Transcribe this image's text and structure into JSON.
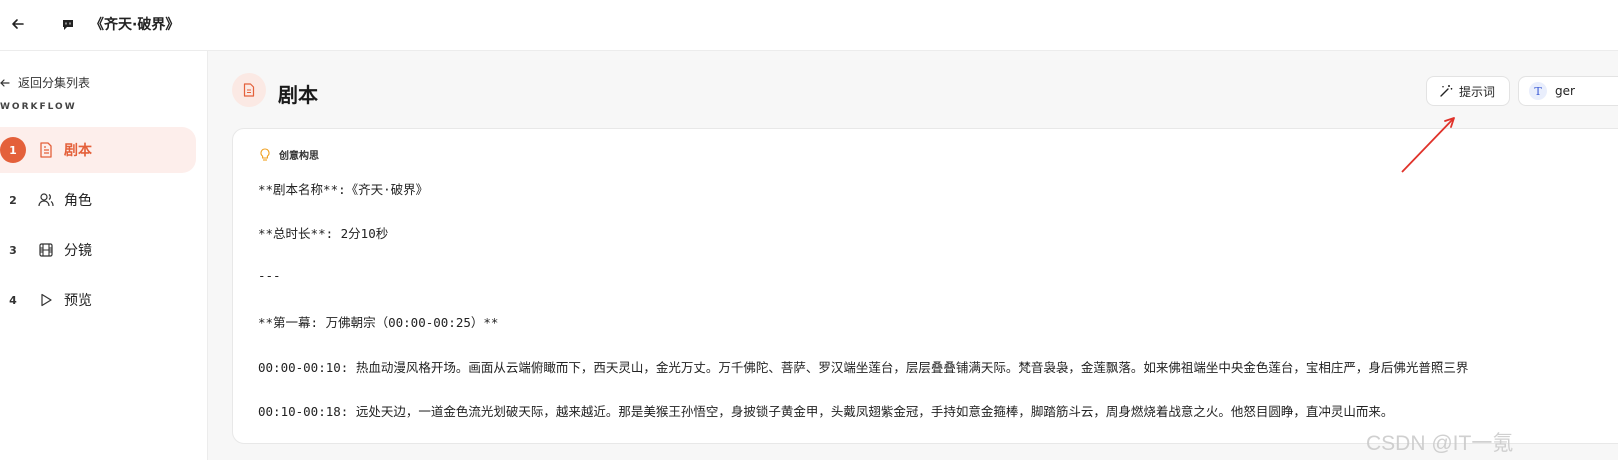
{
  "header": {
    "title": "《齐天·破界》"
  },
  "sidebar": {
    "back_label": "返回分集列表",
    "workflow_label": "WORKFLOW",
    "items": [
      {
        "num": "1",
        "label": "剧本",
        "icon": "document-icon",
        "active": true
      },
      {
        "num": "2",
        "label": "角色",
        "icon": "users-icon",
        "active": false
      },
      {
        "num": "3",
        "label": "分镜",
        "icon": "film-icon",
        "active": false
      },
      {
        "num": "4",
        "label": "预览",
        "icon": "play-icon",
        "active": false
      }
    ]
  },
  "main": {
    "title": "剧本",
    "prompt_button": "提示词",
    "model_button": "ger",
    "card_title": "创意构思",
    "lines": [
      "**剧本名称**:《齐天·破界》",
      "**总时长**: 2分10秒",
      "---",
      "**第一幕: 万佛朝宗（00:00-00:25）**",
      "00:00-00:10: 热血动漫风格开场。画面从云端俯瞰而下，西天灵山，金光万丈。万千佛陀、菩萨、罗汉端坐莲台，层层叠叠铺满天际。梵音袅袅，金莲飘落。如来佛祖端坐中央金色莲台，宝相庄严，身后佛光普照三界",
      "00:10-00:18: 远处天边，一道金色流光划破天际，越来越近。那是美猴王孙悟空，身披锁子黄金甲，头戴凤翅紫金冠，手持如意金箍棒，脚踏筋斗云，周身燃烧着战意之火。他怒目圆睁，直冲灵山而来。"
    ]
  },
  "watermark": "CSDN @IT一氪",
  "colors": {
    "accent": "#e4603a",
    "accent_bg": "#fdeeeb",
    "annotation_arrow": "#e0322a"
  }
}
